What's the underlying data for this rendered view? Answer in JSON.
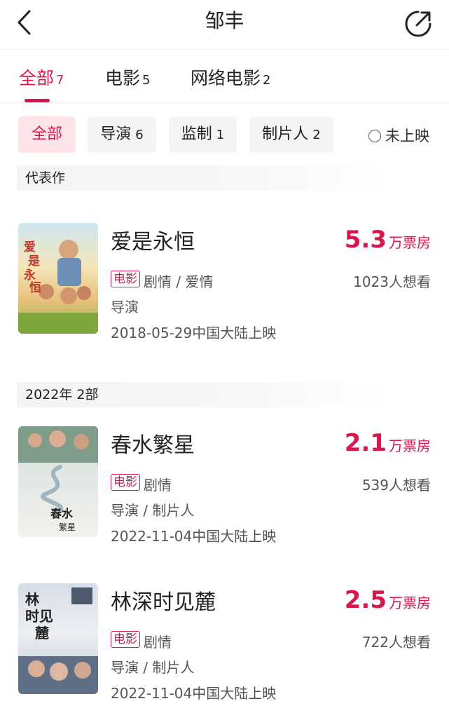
{
  "header": {
    "title": "邹丰"
  },
  "tabs": [
    {
      "label": "全部",
      "count": "7",
      "active": true
    },
    {
      "label": "电影",
      "count": "5"
    },
    {
      "label": "网络电影",
      "count": "2"
    }
  ],
  "filters": {
    "chips": [
      {
        "label": "全部",
        "count": ""
      },
      {
        "label": "导演",
        "count": "6"
      },
      {
        "label": "监制",
        "count": "1"
      },
      {
        "label": "制片人",
        "count": "2"
      }
    ],
    "unreleased_label": "未上映"
  },
  "sections": [
    {
      "header": "代表作",
      "movies": [
        {
          "title": "爱是永恒",
          "boxoffice": "5.3",
          "boxoffice_unit": "万票房",
          "type": "电影",
          "genre": "剧情 / 爱情",
          "wish": "1023人想看",
          "roles": "导演",
          "release": "2018-05-29中国大陆上映",
          "poster_text": "爱是永恒"
        }
      ]
    },
    {
      "header": "2022年 2部",
      "movies": [
        {
          "title": "春水繁星",
          "boxoffice": "2.1",
          "boxoffice_unit": "万票房",
          "type": "电影",
          "genre": "剧情",
          "wish": "539人想看",
          "roles": "导演 / 制片人",
          "release": "2022-11-04中国大陆上映",
          "poster_text": "春水繁星"
        },
        {
          "title": "林深时见麓",
          "boxoffice": "2.5",
          "boxoffice_unit": "万票房",
          "type": "电影",
          "genre": "剧情",
          "wish": "722人想看",
          "roles": "导演 / 制片人",
          "release": "2022-11-04中国大陆上映",
          "poster_text": "林深时见麓"
        }
      ]
    }
  ]
}
